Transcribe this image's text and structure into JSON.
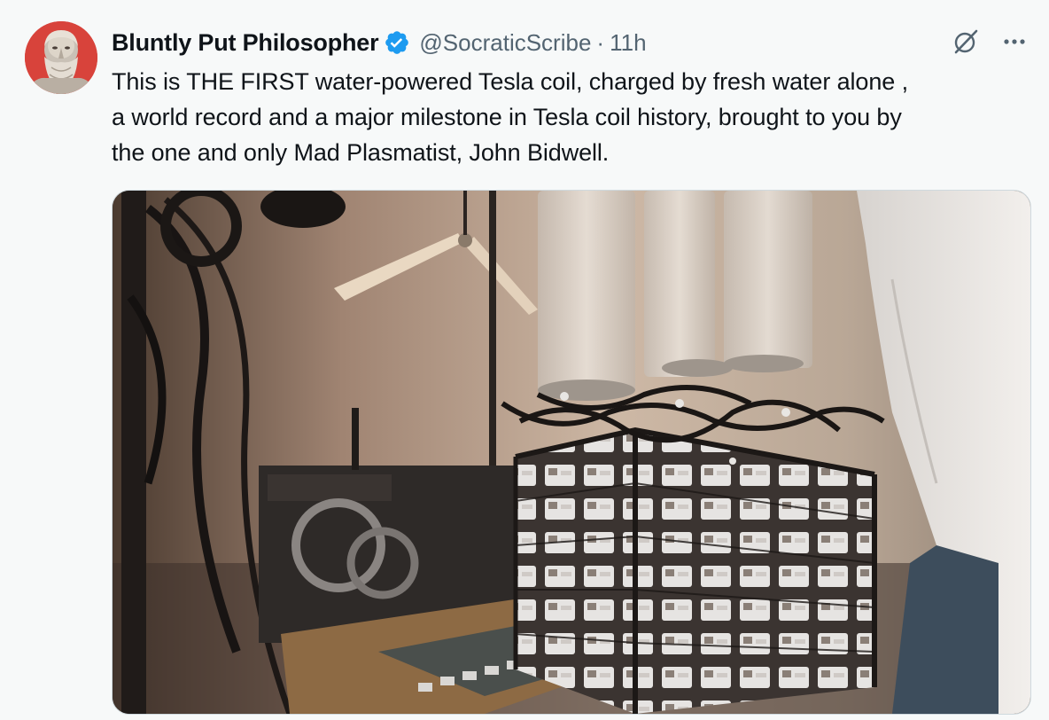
{
  "tweet": {
    "author_name": "Bluntly Put Philosopher",
    "handle": "@SocraticScribe",
    "separator": "·",
    "time": "11h",
    "text_lines": [
      "This is THE FIRST water-powered Tesla coil, charged by fresh water alone ,",
      "a world record and a major milestone in Tesla coil history, brought to you by",
      "the one and only Mad Plasmatist, John Bidwell."
    ]
  },
  "icons": {
    "verified": "verified-badge-icon",
    "grok": "grok-icon",
    "more": "more-dots-icon"
  },
  "colors": {
    "verified": "#1d9bf0",
    "text": "#0f1419",
    "secondary": "#536471",
    "avatar_bg": "#d8433b"
  }
}
